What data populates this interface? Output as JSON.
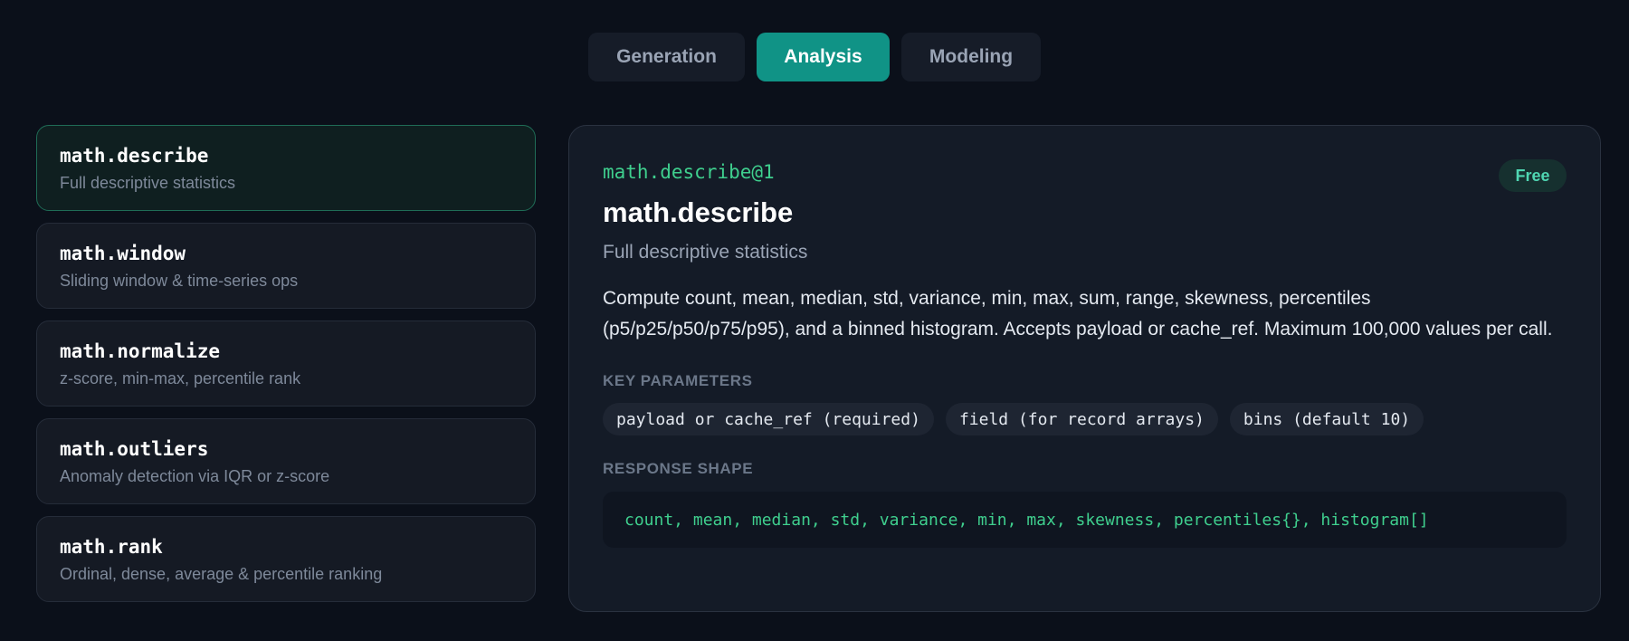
{
  "tabs": [
    {
      "label": "Generation",
      "active": false
    },
    {
      "label": "Analysis",
      "active": true
    },
    {
      "label": "Modeling",
      "active": false
    }
  ],
  "sidebar": {
    "items": [
      {
        "name": "math.describe",
        "desc": "Full descriptive statistics",
        "selected": true
      },
      {
        "name": "math.window",
        "desc": "Sliding window & time-series ops",
        "selected": false
      },
      {
        "name": "math.normalize",
        "desc": "z-score, min-max, percentile rank",
        "selected": false
      },
      {
        "name": "math.outliers",
        "desc": "Anomaly detection via IQR or z-score",
        "selected": false
      },
      {
        "name": "math.rank",
        "desc": "Ordinal, dense, average & percentile ranking",
        "selected": false
      }
    ]
  },
  "detail": {
    "id": "math.describe@1",
    "badge": "Free",
    "title": "math.describe",
    "subtitle": "Full descriptive statistics",
    "body": "Compute count, mean, median, std, variance, min, max, sum, range, skewness, percentiles (p5/p25/p50/p75/p95), and a binned histogram. Accepts payload or cache_ref. Maximum 100,000 values per call.",
    "params_label": "KEY PARAMETERS",
    "params": [
      "payload or cache_ref (required)",
      "field (for record arrays)",
      "bins (default 10)"
    ],
    "response_label": "RESPONSE SHAPE",
    "response": "count, mean, median, std, variance, min, max, skewness, percentiles{}, histogram[]"
  },
  "colors": {
    "accent": "#109386",
    "code_green": "#3fcf8e",
    "badge_text": "#4fd6b2"
  }
}
